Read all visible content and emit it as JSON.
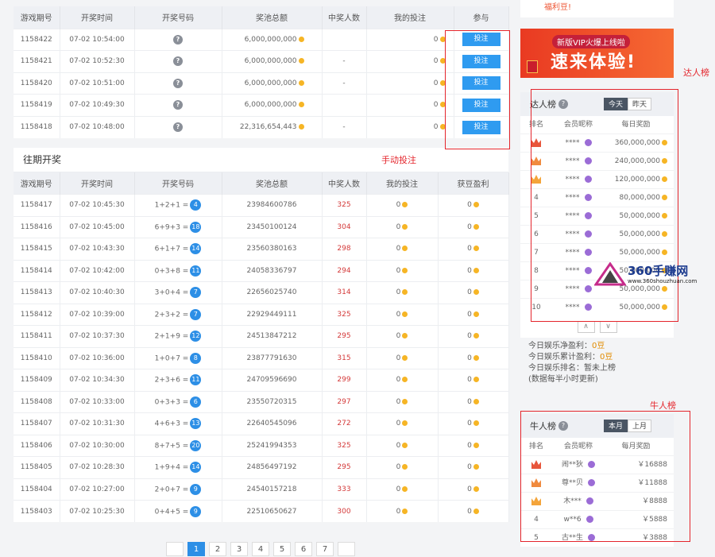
{
  "current": {
    "headers": [
      "游戏期号",
      "开奖时间",
      "开奖号码",
      "奖池总额",
      "中奖人数",
      "我的投注",
      "参与"
    ],
    "rows": [
      {
        "id": "1158422",
        "time": "07-02 10:54:00",
        "pool": "6,000,000,000",
        "winners": "",
        "bet": "0",
        "action": "投注"
      },
      {
        "id": "1158421",
        "time": "07-02 10:52:30",
        "pool": "6,000,000,000",
        "winners": "-",
        "bet": "0",
        "action": "投注"
      },
      {
        "id": "1158420",
        "time": "07-02 10:51:00",
        "pool": "6,000,000,000",
        "winners": "-",
        "bet": "0",
        "action": "投注"
      },
      {
        "id": "1158419",
        "time": "07-02 10:49:30",
        "pool": "6,000,000,000",
        "winners": "",
        "bet": "0",
        "action": "投注"
      },
      {
        "id": "1158418",
        "time": "07-02 10:48:00",
        "pool": "22,316,654,443",
        "winners": "-",
        "bet": "0",
        "action": "投注"
      }
    ]
  },
  "past": {
    "title": "往期开奖",
    "headers": [
      "游戏期号",
      "开奖时间",
      "开奖号码",
      "奖池总额",
      "中奖人数",
      "我的投注",
      "获豆盈利"
    ],
    "rows": [
      {
        "id": "1158417",
        "time": "07-02 10:45:30",
        "expr": "1+2+1 =",
        "res": "4",
        "pool": "23984600786",
        "winners": "325",
        "bet": "0",
        "profit": "0"
      },
      {
        "id": "1158416",
        "time": "07-02 10:45:00",
        "expr": "6+9+3 =",
        "res": "18",
        "pool": "23450100124",
        "winners": "304",
        "bet": "0",
        "profit": "0"
      },
      {
        "id": "1158415",
        "time": "07-02 10:43:30",
        "expr": "6+1+7 =",
        "res": "14",
        "pool": "23560380163",
        "winners": "298",
        "bet": "0",
        "profit": "0"
      },
      {
        "id": "1158414",
        "time": "07-02 10:42:00",
        "expr": "0+3+8 =",
        "res": "11",
        "pool": "24058336797",
        "winners": "294",
        "bet": "0",
        "profit": "0"
      },
      {
        "id": "1158413",
        "time": "07-02 10:40:30",
        "expr": "3+0+4 =",
        "res": "7",
        "pool": "22656025740",
        "winners": "314",
        "bet": "0",
        "profit": "0"
      },
      {
        "id": "1158412",
        "time": "07-02 10:39:00",
        "expr": "2+3+2 =",
        "res": "7",
        "pool": "22929449111",
        "winners": "325",
        "bet": "0",
        "profit": "0"
      },
      {
        "id": "1158411",
        "time": "07-02 10:37:30",
        "expr": "2+1+9 =",
        "res": "12",
        "pool": "24513847212",
        "winners": "295",
        "bet": "0",
        "profit": "0"
      },
      {
        "id": "1158410",
        "time": "07-02 10:36:00",
        "expr": "1+0+7 =",
        "res": "8",
        "pool": "23877791630",
        "winners": "315",
        "bet": "0",
        "profit": "0"
      },
      {
        "id": "1158409",
        "time": "07-02 10:34:30",
        "expr": "2+3+6 =",
        "res": "11",
        "pool": "24709596690",
        "winners": "299",
        "bet": "0",
        "profit": "0"
      },
      {
        "id": "1158408",
        "time": "07-02 10:33:00",
        "expr": "0+3+3 =",
        "res": "6",
        "pool": "23550720315",
        "winners": "297",
        "bet": "0",
        "profit": "0"
      },
      {
        "id": "1158407",
        "time": "07-02 10:31:30",
        "expr": "4+6+3 =",
        "res": "13",
        "pool": "22640545096",
        "winners": "272",
        "bet": "0",
        "profit": "0"
      },
      {
        "id": "1158406",
        "time": "07-02 10:30:00",
        "expr": "8+7+5 =",
        "res": "20",
        "pool": "25241994353",
        "winners": "325",
        "bet": "0",
        "profit": "0"
      },
      {
        "id": "1158405",
        "time": "07-02 10:28:30",
        "expr": "1+9+4 =",
        "res": "14",
        "pool": "24856497192",
        "winners": "295",
        "bet": "0",
        "profit": "0"
      },
      {
        "id": "1158404",
        "time": "07-02 10:27:00",
        "expr": "2+0+7 =",
        "res": "9",
        "pool": "24540157218",
        "winners": "333",
        "bet": "0",
        "profit": "0"
      },
      {
        "id": "1158403",
        "time": "07-02 10:25:30",
        "expr": "0+4+5 =",
        "res": "9",
        "pool": "22510650627",
        "winners": "300",
        "bet": "0",
        "profit": "0"
      }
    ]
  },
  "pager": [
    "1",
    "2",
    "3",
    "4",
    "5",
    "6",
    "7"
  ],
  "right": {
    "top_text": "福利豆!",
    "banner": {
      "line1": "新版VIP火爆上线啦",
      "line2": "速来体验!"
    },
    "daren": {
      "title": "达人榜",
      "tab_today": "今天",
      "tab_yesterday": "昨天",
      "headers": [
        "排名",
        "会员昵称",
        "每日奖励"
      ],
      "rows": [
        {
          "rank": "1",
          "name": "****",
          "reward": "360,000,000"
        },
        {
          "rank": "2",
          "name": "****",
          "reward": "240,000,000"
        },
        {
          "rank": "3",
          "name": "****",
          "reward": "120,000,000"
        },
        {
          "rank": "4",
          "name": "****",
          "reward": "80,000,000"
        },
        {
          "rank": "5",
          "name": "****",
          "reward": "50,000,000"
        },
        {
          "rank": "6",
          "name": "****",
          "reward": "50,000,000"
        },
        {
          "rank": "7",
          "name": "****",
          "reward": "50,000,000"
        },
        {
          "rank": "8",
          "name": "****",
          "reward": "50,000,000"
        },
        {
          "rank": "9",
          "name": "****",
          "reward": "50,000,000"
        },
        {
          "rank": "10",
          "name": "****",
          "reward": "50,000,000"
        }
      ]
    },
    "stats": {
      "l1_label": "今日娱乐净盈利：",
      "l1_val": "0豆",
      "l2_label": "今日娱乐累计盈利：",
      "l2_val": "0豆",
      "l3": "今日娱乐排名：暂未上榜",
      "l4": "(数据每半小时更新)"
    },
    "niuren": {
      "title": "牛人榜",
      "tab_month": "本月",
      "tab_last": "上月",
      "headers": [
        "排名",
        "会员昵称",
        "每月奖励"
      ],
      "rows": [
        {
          "rank": "1",
          "name": "闹**狄",
          "reward": "￥16888"
        },
        {
          "rank": "2",
          "name": "尊**贝",
          "reward": "￥11888"
        },
        {
          "rank": "3",
          "name": "木***",
          "reward": "￥8888"
        },
        {
          "rank": "4",
          "name": "w**6",
          "reward": "￥5888"
        },
        {
          "rank": "5",
          "name": "古**生",
          "reward": "￥3888"
        }
      ]
    }
  },
  "annotations": {
    "manual": "手动投注",
    "daren": "达人榜",
    "niuren": "牛人榜"
  },
  "watermark": {
    "brand": "360手赚网",
    "url": "www.360shouzhuan.com"
  }
}
